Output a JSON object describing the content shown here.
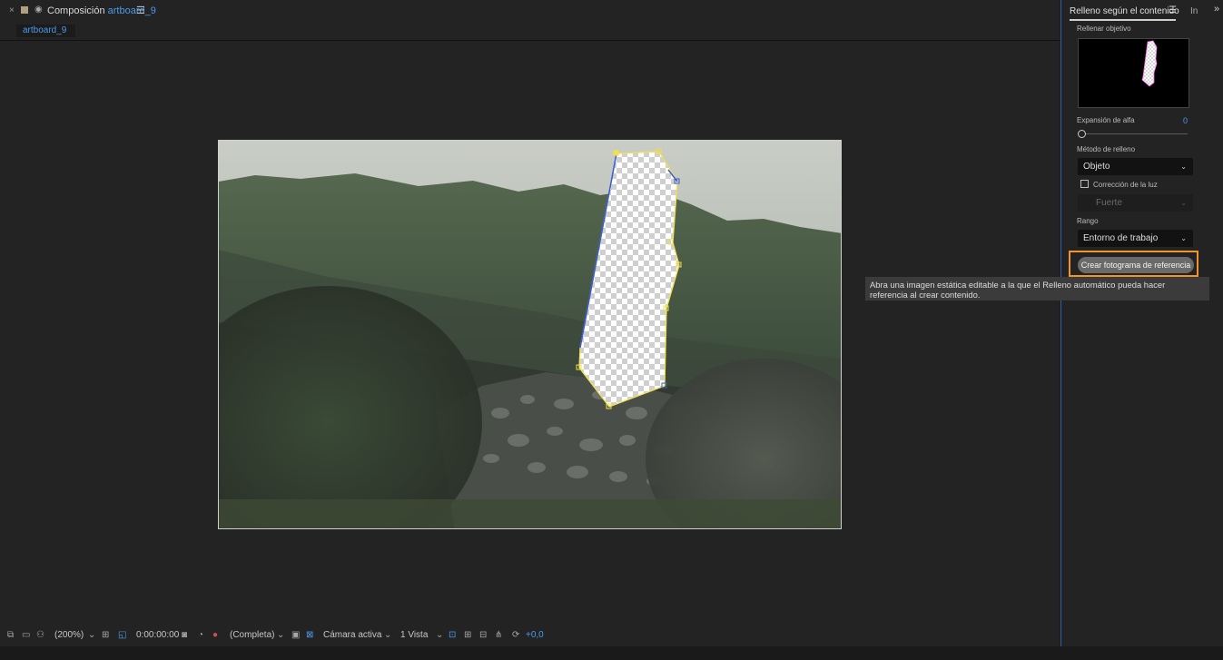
{
  "composition": {
    "close_glyph": "×",
    "lock_glyph": "🔓",
    "title_prefix": "Composición",
    "name": "artboard_9",
    "menu_glyph": "☰",
    "tab_label": "artboard_9"
  },
  "toolbar": {
    "zoom": "(200%)",
    "timecode": "0:00:00:00",
    "resolution": "(Completa)",
    "camera": "Cámara activa",
    "views": "1 Vista",
    "exposure": "+0,0",
    "chevron": "⌄"
  },
  "panel": {
    "title": "Relleno según el contenido",
    "menu_glyph": "☰",
    "next_tab": "In",
    "expand_glyph": "»",
    "target_fill_label": "Rellenar objetivo",
    "alpha_expansion_label": "Expansión de alfa",
    "alpha_expansion_value": "0",
    "fill_method_label": "Método de relleno",
    "fill_method_value": "Objeto",
    "light_correction_label": "Corrección de la luz",
    "light_correction_checked": false,
    "light_strength_value": "Fuerte",
    "range_label": "Rango",
    "range_value": "Entorno de trabajo",
    "create_reference_button": "Crear fotograma de referencia",
    "chevron": "⌄"
  },
  "tooltip": {
    "text": "Abra una imagen estática editable a la que el Relleno automático pueda hacer referencia al crear contenido."
  },
  "colors": {
    "accent_blue": "#4a9bea",
    "highlight_orange": "#f0952e",
    "mask_yellow": "#f2e14a",
    "panel_border": "#2d5fb8"
  }
}
